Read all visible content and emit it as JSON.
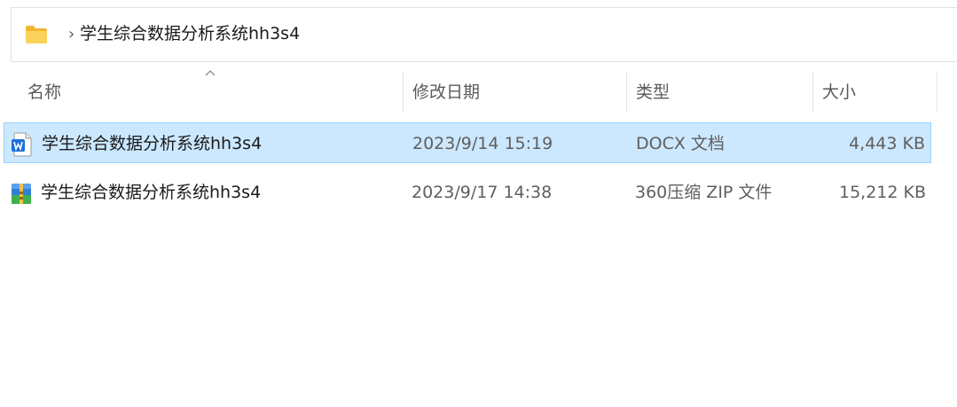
{
  "address_bar": {
    "path_label": "学生综合数据分析系统hh3s4"
  },
  "columns": {
    "name": "名称",
    "modified": "修改日期",
    "type": "类型",
    "size": "大小",
    "sorted_by": "name",
    "sort_direction": "ascending"
  },
  "files": [
    {
      "name": "学生综合数据分析系统hh3s4",
      "modified": "2023/9/14 15:19",
      "type": "DOCX 文档",
      "size": "4,443 KB",
      "icon": "word-document-icon",
      "selected": true
    },
    {
      "name": "学生综合数据分析系统hh3s4",
      "modified": "2023/9/17 14:38",
      "type": "360压缩 ZIP 文件",
      "size": "15,212 KB",
      "icon": "zip-archive-icon",
      "selected": false
    }
  ],
  "colors": {
    "selection_bg": "#cce8ff",
    "selection_border": "#99d1ff",
    "folder_yellow": "#f8c94a",
    "word_blue": "#1e6fd9"
  }
}
